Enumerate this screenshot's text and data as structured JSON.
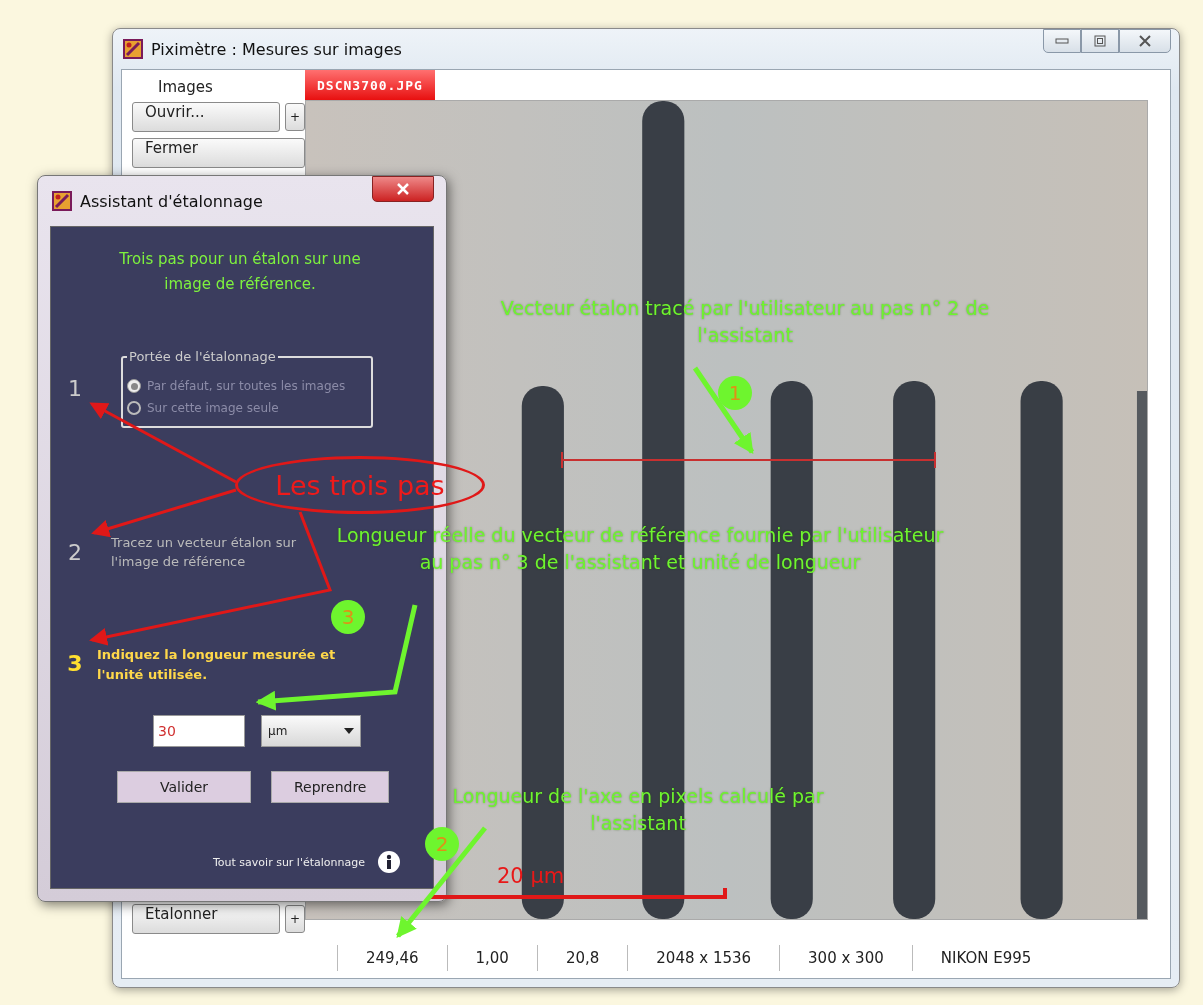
{
  "main_window": {
    "title": "Piximètre : Mesures sur images",
    "sidebar": {
      "group_label": "Images",
      "buttons": [
        {
          "label": "Ouvrir...",
          "plus": "+"
        },
        {
          "label": "Fermer"
        }
      ],
      "bottom_button": {
        "label": "Etalonner",
        "plus": "+"
      }
    },
    "image_tab": {
      "label": "DSCN3700.JPG",
      "selected": true
    },
    "scale_bar": "20 µm",
    "status_bar": [
      "249,46",
      "1,00",
      "20,8",
      "2048 x 1536",
      "300 x 300",
      "NIKON E995"
    ]
  },
  "dialog": {
    "title": "Assistant d'étalonnage",
    "intro": "Trois pas pour un étalon sur une image de référence.",
    "steps": [
      {
        "kind": "scope",
        "number": "1",
        "group_label": "Portée de l'étalonnage",
        "options": [
          {
            "label": "Par défaut, sur toutes les images",
            "selected": true
          },
          {
            "label": "Sur cette image seule",
            "selected": false
          }
        ]
      },
      {
        "kind": "vector",
        "number": "2",
        "text": "Tracez un vecteur étalon sur l'image de référence"
      },
      {
        "kind": "length",
        "number": "3",
        "text": "Indiquez la longueur mesurée et l'unité utilisée.",
        "value": "30",
        "unit": "µm"
      }
    ],
    "buttons": [
      "Valider",
      "Reprendre"
    ],
    "help": "Tout savoir sur l'étalonnage"
  },
  "annotations": {
    "oval_label": "Les trois pas",
    "callouts": [
      {
        "number": "1",
        "text": "Vecteur étalon tracé par l'utilisateur au pas n° 2 de l'assistant"
      },
      {
        "number": "3",
        "text": "Longueur réelle du vecteur de référence fournie par l'utilisateur au pas n° 3 de l'assistant et unité de longueur"
      },
      {
        "number": "2",
        "text": "Longueur de l'axe en pixels calculé par l'assistant"
      }
    ]
  }
}
